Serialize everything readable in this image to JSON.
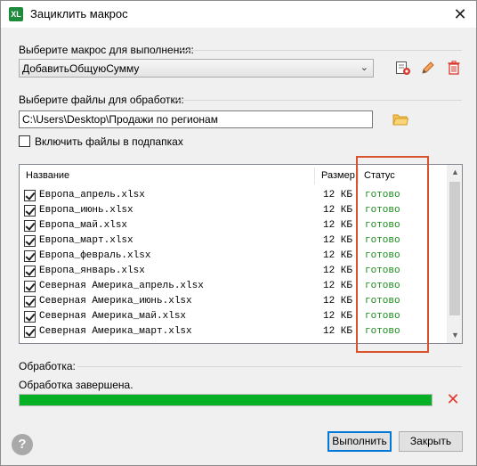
{
  "window": {
    "icon_text": "XL",
    "title": "Зациклить макрос",
    "close_glyph": "✕"
  },
  "macro": {
    "label": "Выберите макрос для выполнения:",
    "selected": "ДобавитьОбщуюСумму",
    "icons": [
      "record-macro-icon",
      "pencil-icon",
      "trash-icon"
    ]
  },
  "files": {
    "label": "Выберите файлы для обработки:",
    "path": "C:\\Users\\Desktop\\Продажи по регионам",
    "folder_icon": "folder-icon",
    "include_subfolders_label": "Включить файлы в подпапках",
    "include_subfolders_checked": false
  },
  "list": {
    "columns": {
      "name": "Название",
      "size": "Размер",
      "status": "Статус"
    },
    "rows": [
      {
        "name": "Европа_апрель.xlsx",
        "size": "12 КБ",
        "status": "готово",
        "checked": true
      },
      {
        "name": "Европа_июнь.xlsx",
        "size": "12 КБ",
        "status": "готово",
        "checked": true
      },
      {
        "name": "Европа_май.xlsx",
        "size": "12 КБ",
        "status": "готово",
        "checked": true
      },
      {
        "name": "Европа_март.xlsx",
        "size": "12 КБ",
        "status": "готово",
        "checked": true
      },
      {
        "name": "Европа_февраль.xlsx",
        "size": "12 КБ",
        "status": "готово",
        "checked": true
      },
      {
        "name": "Европа_январь.xlsx",
        "size": "12 КБ",
        "status": "готово",
        "checked": true
      },
      {
        "name": "Северная Америка_апрель.xlsx",
        "size": "12 КБ",
        "status": "готово",
        "checked": true
      },
      {
        "name": "Северная Америка_июнь.xlsx",
        "size": "12 КБ",
        "status": "готово",
        "checked": true
      },
      {
        "name": "Северная Америка_май.xlsx",
        "size": "12 КБ",
        "status": "готово",
        "checked": true
      },
      {
        "name": "Северная Америка_март.xlsx",
        "size": "12 КБ",
        "status": "готово",
        "checked": true
      }
    ]
  },
  "processing": {
    "label": "Обработка:",
    "status": "Обработка завершена.",
    "progress": 1.0,
    "progress_color": "#06b025"
  },
  "buttons": {
    "run": "Выполнить",
    "close": "Закрыть",
    "help": "?"
  },
  "colors": {
    "status_done": "#1a8c1a",
    "highlight": "#d9542c",
    "cancel": "#e03c31"
  }
}
